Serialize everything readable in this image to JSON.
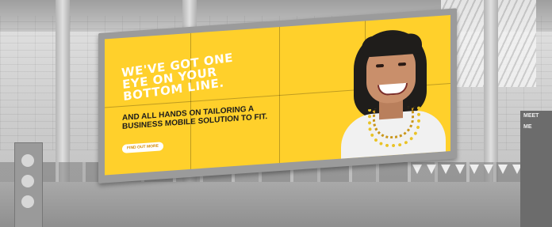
{
  "billboard": {
    "headline": [
      "WE'VE GOT ONE",
      "EYE ON YOUR",
      "BOTTOM LINE."
    ],
    "subhead": [
      "AND ALL HANDS ON TAILORING A",
      "BUSINESS MOBILE SOLUTION TO FIT."
    ],
    "cta": "FIND OUT MORE",
    "colors": {
      "background": "#ffd02b",
      "headline": "#ffffff",
      "subhead": "#1b1b1b",
      "cta_text": "#d48a00"
    }
  },
  "signage": {
    "right_sign_lines": [
      "MEET",
      "ME"
    ]
  }
}
